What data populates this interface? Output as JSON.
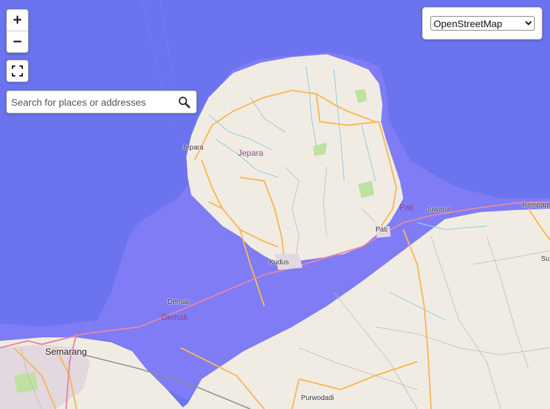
{
  "map": {
    "colors": {
      "water": "#6b74ee",
      "flood": "#7f7cf5",
      "land": "#f1ece3",
      "highway": "#f7b859",
      "city": "#e3d8df",
      "park": "#bfe1a2"
    },
    "labels": {
      "jepara_town": "Jepara",
      "jepara_region": "Jepara",
      "kudus": "Kudus",
      "pati_region": "Pati",
      "pati_town": "Pati",
      "juwana": "Juwana",
      "rembang": "Rembang",
      "demak_town": "Demak",
      "demak_region": "Demak",
      "semarang": "Semarang",
      "purwodadi": "Purwodadi",
      "su": "Su"
    }
  },
  "controls": {
    "zoom_in_label": "+",
    "zoom_out_label": "−",
    "fullscreen_icon": "fullscreen-icon",
    "search_placeholder": "Search for places or addresses",
    "search_icon": "magnifier-icon",
    "layer_select_value": "OpenStreetMap",
    "layer_options": [
      "OpenStreetMap"
    ]
  }
}
